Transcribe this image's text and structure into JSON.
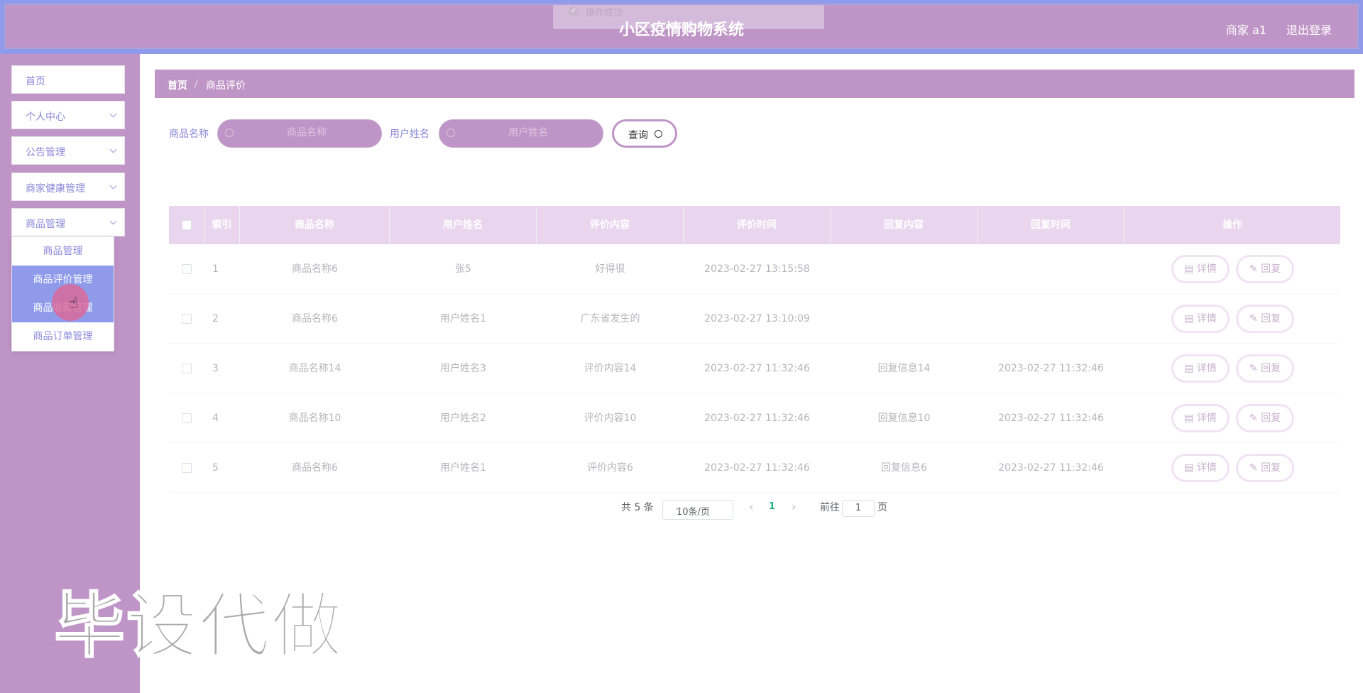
{
  "header": {
    "title": "小区疫情购物系统",
    "user": "商家 a1",
    "logout": "退出登录"
  },
  "toast": {
    "text": "操作成功"
  },
  "sidebar": {
    "items": [
      {
        "label": "首页"
      },
      {
        "label": "个人中心"
      },
      {
        "label": "公告管理"
      },
      {
        "label": "商家健康管理"
      },
      {
        "label": "商品管理"
      }
    ],
    "submenu": [
      {
        "label": "商品管理"
      },
      {
        "label": "商品评价管理"
      },
      {
        "label": "商品收藏管理"
      },
      {
        "label": "商品订单管理"
      }
    ]
  },
  "breadcrumb": {
    "home": "首页",
    "separator": "/",
    "current": "商品评价"
  },
  "search": {
    "product_label": "商品名称",
    "product_placeholder": "商品名称",
    "user_label": "用户姓名",
    "user_placeholder": "用户姓名",
    "query_label": "查询"
  },
  "table": {
    "headers": [
      "索引",
      "商品名称",
      "用户姓名",
      "评价内容",
      "评价时间",
      "回复内容",
      "回复时间",
      "操作"
    ],
    "rows": [
      {
        "index": "1",
        "product": "商品名称6",
        "user": "张5",
        "content": "好得很",
        "time": "2023-02-27 13:15:58",
        "reply": "",
        "reply_time": ""
      },
      {
        "index": "2",
        "product": "商品名称6",
        "user": "用户姓名1",
        "content": "广东省发生的",
        "time": "2023-02-27 13:10:09",
        "reply": "",
        "reply_time": ""
      },
      {
        "index": "3",
        "product": "商品名称14",
        "user": "用户姓名3",
        "content": "评价内容14",
        "time": "2023-02-27 11:32:46",
        "reply": "回复信息14",
        "reply_time": "2023-02-27 11:32:46"
      },
      {
        "index": "4",
        "product": "商品名称10",
        "user": "用户姓名2",
        "content": "评价内容10",
        "time": "2023-02-27 11:32:46",
        "reply": "回复信息10",
        "reply_time": "2023-02-27 11:32:46"
      },
      {
        "index": "5",
        "product": "商品名称6",
        "user": "用户姓名1",
        "content": "评价内容6",
        "time": "2023-02-27 11:32:46",
        "reply": "回复信息6",
        "reply_time": "2023-02-27 11:32:46"
      }
    ],
    "actions": {
      "detail": "详情",
      "reply": "回复"
    }
  },
  "pagination": {
    "total": "共 5 条",
    "page_size": "10条/页",
    "current_page": "1",
    "goto_label": "前往",
    "goto_value": "1",
    "page_suffix": "页"
  },
  "watermark": "毕设代做"
}
